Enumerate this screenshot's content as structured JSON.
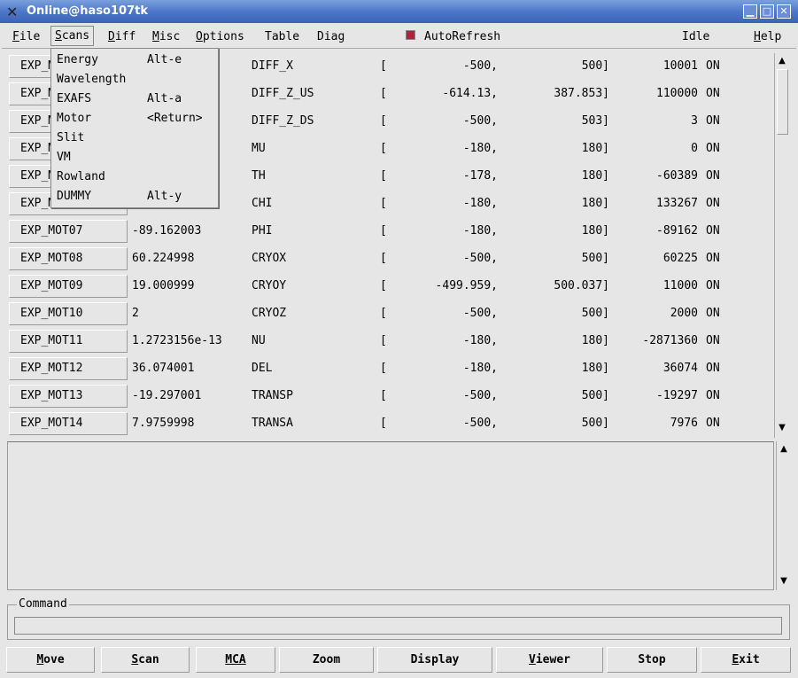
{
  "window": {
    "title": "Online@haso107tk",
    "minimize_label": "▁",
    "maximize_label": "□",
    "close_label": "✕"
  },
  "menubar": {
    "items": [
      {
        "label": "File",
        "underline": "F",
        "rest": "ile"
      },
      {
        "label": "Scans",
        "underline": "S",
        "rest": "cans"
      },
      {
        "label": "Diff",
        "underline": "D",
        "rest": "iff"
      },
      {
        "label": "Misc",
        "underline": "M",
        "rest": "isc"
      },
      {
        "label": "Options",
        "underline": "O",
        "rest": "ptions"
      },
      {
        "label": "Table"
      },
      {
        "label": "Diag"
      },
      {
        "label": "AutoRefresh"
      },
      {
        "label": "Idle"
      },
      {
        "label": "Help",
        "underline": "H",
        "rest": "elp"
      }
    ],
    "autorefresh_checked": true,
    "checkbox_color": "#b02040"
  },
  "scans_menu": [
    {
      "label": "Energy",
      "accel": "Alt-e"
    },
    {
      "label": "Wavelength",
      "accel": ""
    },
    {
      "label": "EXAFS",
      "accel": "Alt-a"
    },
    {
      "label": "Motor",
      "accel": "<Return>"
    },
    {
      "label": "Slit",
      "accel": ""
    },
    {
      "label": "VM",
      "accel": ""
    },
    {
      "label": "Rowland",
      "accel": ""
    },
    {
      "label": "DUMMY",
      "accel": "Alt-y"
    }
  ],
  "motors": [
    {
      "button": "EXP_MOT01",
      "position": "",
      "name": "DIFF_X",
      "bracket": "[",
      "low": "-500,",
      "high": "500]",
      "steps": "10001",
      "state": "ON"
    },
    {
      "button": "EXP_MOT02",
      "position": "",
      "name": "DIFF_Z_US",
      "bracket": "[",
      "low": "-614.13,",
      "high": "387.853]",
      "steps": "110000",
      "state": "ON"
    },
    {
      "button": "EXP_MOT03",
      "position": "",
      "name": "DIFF_Z_DS",
      "bracket": "[",
      "low": "-500,",
      "high": "503]",
      "steps": "3",
      "state": "ON"
    },
    {
      "button": "EXP_MOT04",
      "position": "",
      "name": "MU",
      "bracket": "[",
      "low": "-180,",
      "high": "180]",
      "steps": "0",
      "state": "ON"
    },
    {
      "button": "EXP_MOT05",
      "position": "",
      "name": "TH",
      "bracket": "[",
      "low": "-178,",
      "high": "180]",
      "steps": "-60389",
      "state": "ON"
    },
    {
      "button": "EXP_MOT06",
      "position": "",
      "name": "CHI",
      "bracket": "[",
      "low": "-180,",
      "high": "180]",
      "steps": "133267",
      "state": "ON"
    },
    {
      "button": "EXP_MOT07",
      "position": "-89.162003",
      "name": "PHI",
      "bracket": "[",
      "low": "-180,",
      "high": "180]",
      "steps": "-89162",
      "state": "ON"
    },
    {
      "button": "EXP_MOT08",
      "position": "60.224998",
      "name": "CRYOX",
      "bracket": "[",
      "low": "-500,",
      "high": "500]",
      "steps": "60225",
      "state": "ON"
    },
    {
      "button": "EXP_MOT09",
      "position": "19.000999",
      "name": "CRYOY",
      "bracket": "[",
      "low": "-499.959,",
      "high": "500.037]",
      "steps": "11000",
      "state": "ON"
    },
    {
      "button": "EXP_MOT10",
      "position": "2",
      "name": "CRYOZ",
      "bracket": "[",
      "low": "-500,",
      "high": "500]",
      "steps": "2000",
      "state": "ON"
    },
    {
      "button": "EXP_MOT11",
      "position": "1.2723156e-13",
      "name": "NU",
      "bracket": "[",
      "low": "-180,",
      "high": "180]",
      "steps": "-2871360",
      "state": "ON"
    },
    {
      "button": "EXP_MOT12",
      "position": "36.074001",
      "name": "DEL",
      "bracket": "[",
      "low": "-180,",
      "high": "180]",
      "steps": "36074",
      "state": "ON"
    },
    {
      "button": "EXP_MOT13",
      "position": "-19.297001",
      "name": "TRANSP",
      "bracket": "[",
      "low": "-500,",
      "high": "500]",
      "steps": "-19297",
      "state": "ON"
    },
    {
      "button": "EXP_MOT14",
      "position": "7.9759998",
      "name": "TRANSA",
      "bracket": "[",
      "low": "-500,",
      "high": "500]",
      "steps": "7976",
      "state": "ON"
    }
  ],
  "command": {
    "label": "Command",
    "value": ""
  },
  "bottom_buttons": [
    {
      "label": "Move",
      "underline": "M",
      "rest": "ove"
    },
    {
      "label": "Scan",
      "underline": "S",
      "rest": "can"
    },
    {
      "label": "MCA",
      "underline": "MCA",
      "rest": ""
    },
    {
      "label": "Zoom",
      "underline": "",
      "rest": "Zoom"
    },
    {
      "label": "Display",
      "underline": "",
      "rest": "Display"
    },
    {
      "label": "Viewer",
      "underline": "V",
      "rest": "iewer"
    },
    {
      "label": "Stop",
      "underline": "",
      "rest": "Stop"
    },
    {
      "label": "Exit",
      "underline": "E",
      "rest": "xit"
    }
  ],
  "scroll": {
    "up_arrow": "▲",
    "down_arrow": "▼"
  }
}
